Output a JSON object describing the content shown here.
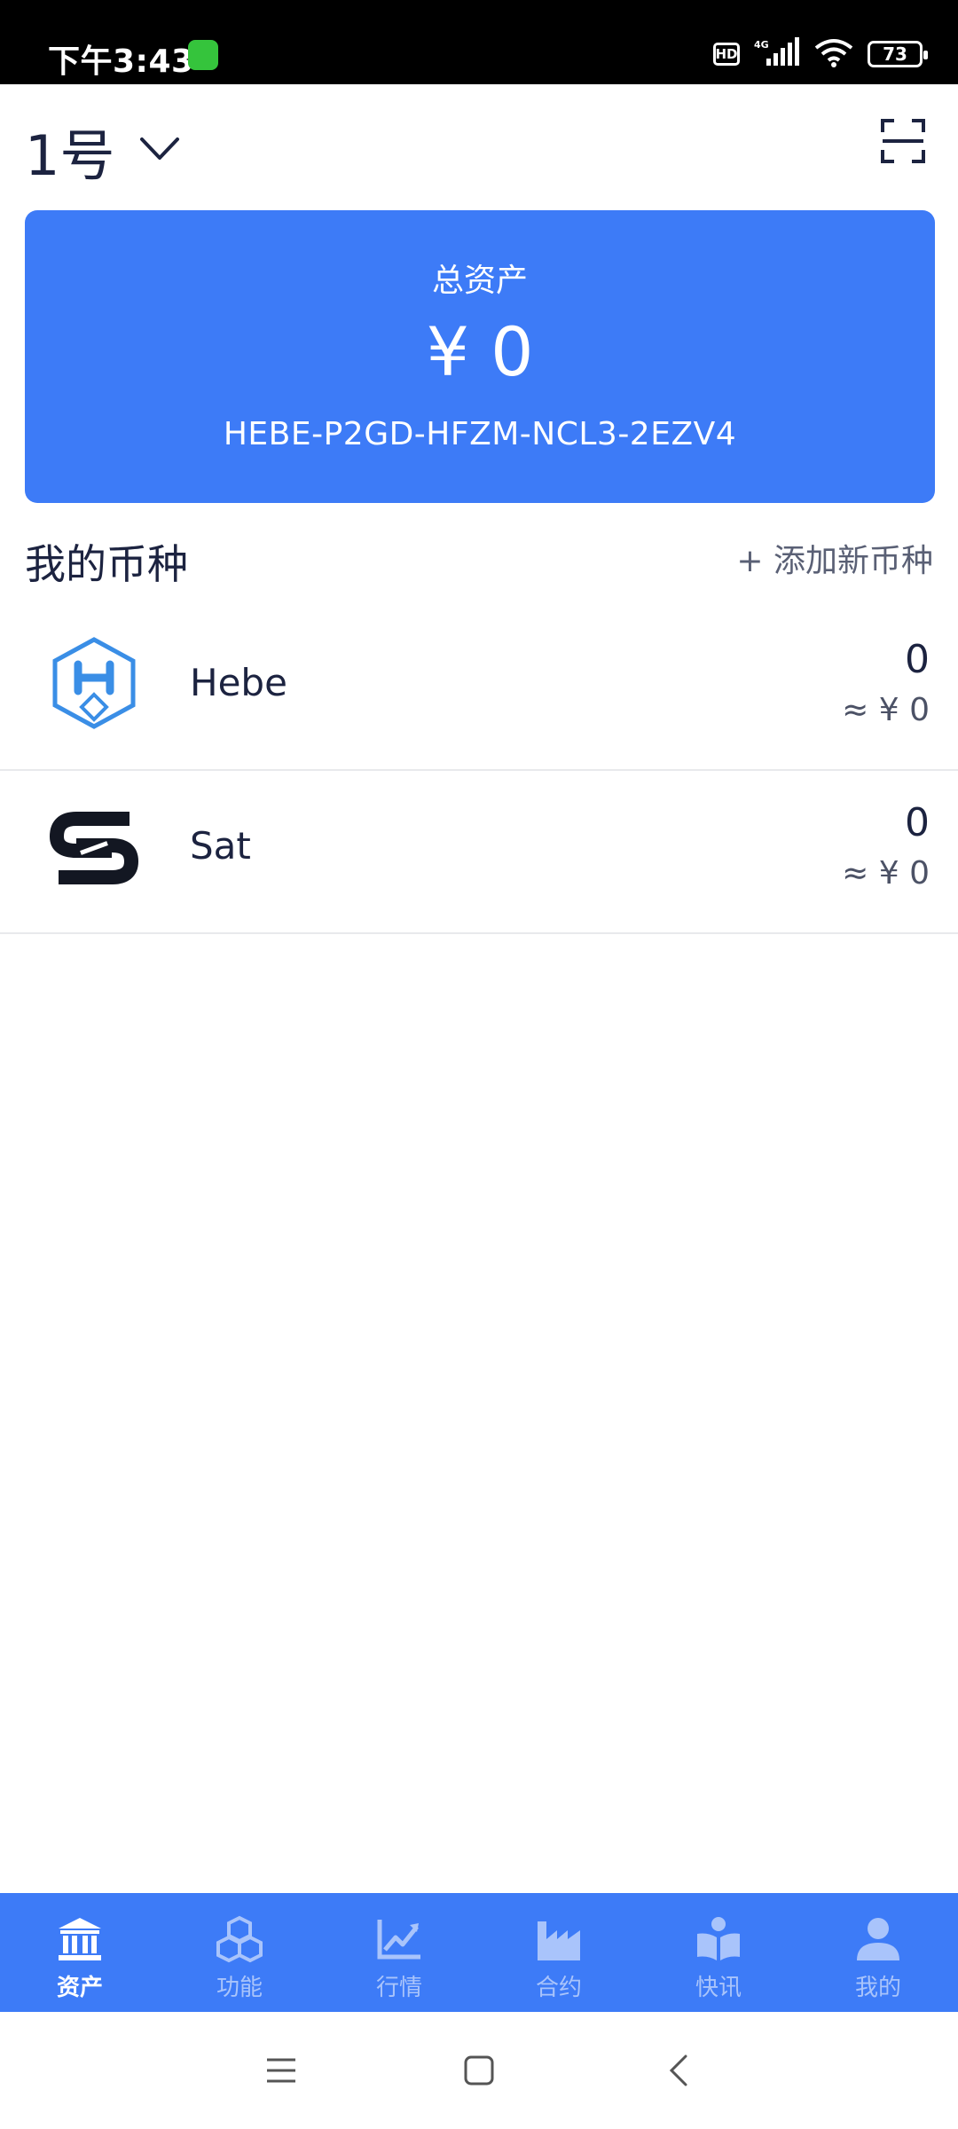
{
  "status_bar": {
    "time": "下午3:43",
    "hd": "HD",
    "network": "4G",
    "battery": "73"
  },
  "header": {
    "account": "1号"
  },
  "asset_card": {
    "label": "总资产",
    "value": "¥ 0",
    "address": "HEBE-P2GD-HFZM-NCL3-2EZV4"
  },
  "coins_section": {
    "title": "我的币种",
    "add_label": "+ 添加新币种"
  },
  "coins": [
    {
      "name": "Hebe",
      "amount": "0",
      "fiat": "≈ ¥ 0",
      "icon": "hebe-logo-icon"
    },
    {
      "name": "Sat",
      "amount": "0",
      "fiat": "≈ ¥ 0",
      "icon": "sat-logo-icon"
    }
  ],
  "tabs": [
    {
      "label": "资产",
      "icon": "bank-icon",
      "active": true
    },
    {
      "label": "功能",
      "icon": "cubes-icon",
      "active": false
    },
    {
      "label": "行情",
      "icon": "chart-line-icon",
      "active": false
    },
    {
      "label": "合约",
      "icon": "factory-icon",
      "active": false
    },
    {
      "label": "快讯",
      "icon": "reader-icon",
      "active": false
    },
    {
      "label": "我的",
      "icon": "user-icon",
      "active": false
    }
  ],
  "colors": {
    "primary": "#3d7bf7",
    "text": "#1c2340",
    "tab_inactive": "#a9c4fb"
  }
}
